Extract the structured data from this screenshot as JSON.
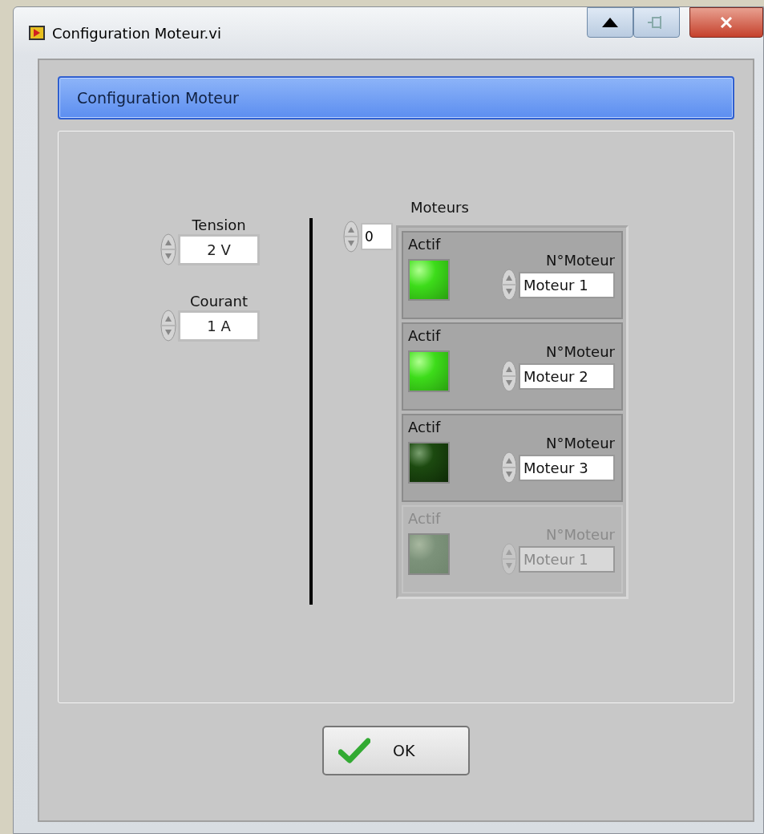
{
  "window": {
    "title": "Configuration Moteur.vi"
  },
  "header": {
    "title": "Configuration Moteur"
  },
  "tension": {
    "label": "Tension",
    "value": "2 V"
  },
  "courant": {
    "label": "Courant",
    "value": "1 A"
  },
  "moteurs": {
    "label": "Moteurs",
    "index": "0",
    "elements": [
      {
        "actif_label": "Actif",
        "on": true,
        "disabled": false,
        "motor_label": "N°Moteur",
        "value": "Moteur 1"
      },
      {
        "actif_label": "Actif",
        "on": true,
        "disabled": false,
        "motor_label": "N°Moteur",
        "value": "Moteur 2"
      },
      {
        "actif_label": "Actif",
        "on": false,
        "disabled": false,
        "motor_label": "N°Moteur",
        "value": "Moteur 3"
      },
      {
        "actif_label": "Actif",
        "on": true,
        "disabled": true,
        "motor_label": "N°Moteur",
        "value": "Moteur 1"
      }
    ]
  },
  "ok_button": {
    "label": "OK"
  }
}
